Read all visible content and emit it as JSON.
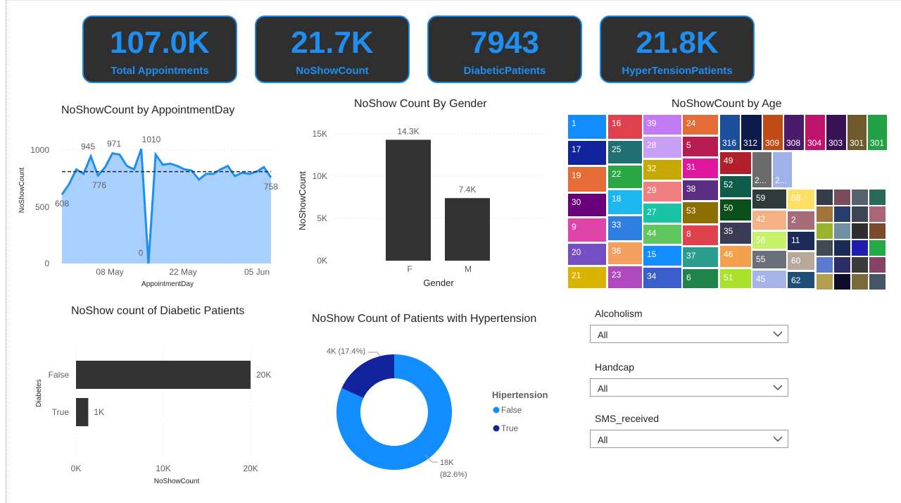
{
  "kpis": [
    {
      "value": "107.0K",
      "label": "Total Appointments"
    },
    {
      "value": "21.7K",
      "label": "NoShowCount"
    },
    {
      "value": "7943",
      "label": "DiabeticPatients"
    },
    {
      "value": "21.8K",
      "label": "HyperTensionPatients"
    }
  ],
  "colors": {
    "kpi_bg": "#2f2f2f",
    "kpi_accent": "#1f8ef1",
    "bar": "#333333",
    "area_fill": "#a8d0ff",
    "line": "#1f8ef1",
    "donut_false": "#118dff",
    "donut_true": "#12239e"
  },
  "charts": {
    "appointment_day": {
      "title": "NoShowCount by AppointmentDay",
      "ylabel": "NoShowCount",
      "xlabel": "AppointmentDay",
      "yticks": [
        "0",
        "500",
        "1000"
      ],
      "xticks": [
        "08 May",
        "22 May",
        "05 Jun"
      ],
      "labels": [
        "608",
        "945",
        "776",
        "971",
        "1010",
        "0",
        "758"
      ]
    },
    "gender": {
      "title": "NoShow Count By Gender",
      "ylabel": "NoShowCount",
      "xlabel": "Gender",
      "yticks": [
        "0K",
        "5K",
        "10K",
        "15K"
      ],
      "labels": [
        "14.3K",
        "7.4K"
      ],
      "categories": [
        "F",
        "M"
      ]
    },
    "age": {
      "title": "NoShowCount by Age"
    },
    "diabetes": {
      "title": "NoShow count of Diabetic Patients",
      "ylabel": "Diabetes",
      "xlabel": "NoShowCount",
      "categories": [
        "False",
        "True"
      ],
      "labels": [
        "20K",
        "1K"
      ],
      "xticks": [
        "0K",
        "10K",
        "20K"
      ]
    },
    "hypertension": {
      "title": "NoShow Count of Patients with Hypertension",
      "legend_title": "Hipertension",
      "legend": [
        "False",
        "True"
      ],
      "label_true": "4K (17.4%)",
      "label_false_1": "18K",
      "label_false_2": "(82.6%)"
    }
  },
  "chart_data": [
    {
      "type": "area",
      "title": "NoShowCount by AppointmentDay",
      "xlabel": "AppointmentDay",
      "ylabel": "NoShowCount",
      "ylim": [
        0,
        1150
      ],
      "values": [
        608,
        700,
        830,
        790,
        945,
        776,
        850,
        971,
        960,
        860,
        830,
        1010,
        0,
        960,
        870,
        880,
        860,
        830,
        820,
        740,
        790,
        790,
        830,
        860,
        770,
        800,
        790,
        810,
        850,
        758
      ],
      "average": 810
    },
    {
      "type": "bar",
      "title": "NoShow Count By Gender",
      "categories": [
        "F",
        "M"
      ],
      "values": [
        14300,
        7400
      ],
      "xlabel": "Gender",
      "ylabel": "NoShowCount",
      "ylim": [
        0,
        15000
      ]
    },
    {
      "type": "bar",
      "title": "NoShow count of Diabetic Patients",
      "categories": [
        "False",
        "True"
      ],
      "values": [
        20000,
        1400
      ],
      "xlabel": "NoShowCount",
      "ylabel": "Diabetes",
      "xlim": [
        0,
        20000
      ]
    },
    {
      "type": "pie",
      "title": "NoShow Count of Patients with Hypertension",
      "categories": [
        "False",
        "True"
      ],
      "values": [
        18000,
        4000
      ],
      "percent": [
        82.6,
        17.4
      ]
    }
  ],
  "treemap": [
    {
      "label": "1",
      "color": "#118dff"
    },
    {
      "label": "16",
      "color": "#e0414f"
    },
    {
      "label": "39",
      "color": "#c37bf5"
    },
    {
      "label": "24",
      "color": "#e66c37"
    },
    {
      "label": "17",
      "color": "#12239e"
    },
    {
      "label": "25",
      "color": "#1f6f73"
    },
    {
      "label": "28",
      "color": "#c89ef6"
    },
    {
      "label": "5",
      "color": "#b61c4d"
    },
    {
      "label": "19",
      "color": "#e66c37"
    },
    {
      "label": "22",
      "color": "#29a745"
    },
    {
      "label": "32",
      "color": "#c8a800"
    },
    {
      "label": "31",
      "color": "#e1169e"
    },
    {
      "label": "30",
      "color": "#6b007b"
    },
    {
      "label": "18",
      "color": "#1ab7f0"
    },
    {
      "label": "29",
      "color": "#f08080"
    },
    {
      "label": "38",
      "color": "#5a2d82"
    },
    {
      "label": "9",
      "color": "#e044a7"
    },
    {
      "label": "33",
      "color": "#2f7fe0"
    },
    {
      "label": "27",
      "color": "#19c4a6"
    },
    {
      "label": "53",
      "color": "#8d6e00"
    },
    {
      "label": "20",
      "color": "#744ec2"
    },
    {
      "label": "36",
      "color": "#f39f5e"
    },
    {
      "label": "44",
      "color": "#5ec85e"
    },
    {
      "label": "8",
      "color": "#e0414f"
    },
    {
      "label": "21",
      "color": "#d9b300"
    },
    {
      "label": "23",
      "color": "#b048c0"
    },
    {
      "label": "15",
      "color": "#118dff"
    },
    {
      "label": "37",
      "color": "#2a9d8f"
    },
    {
      "label": "34",
      "color": "#3a5fcd"
    },
    {
      "label": "6",
      "color": "#1e8449"
    },
    {
      "label": "316",
      "color": "#1b4f9c"
    },
    {
      "label": "312",
      "color": "#0d1b4c"
    },
    {
      "label": "309",
      "color": "#c04b14"
    },
    {
      "label": "308",
      "color": "#4a1a6b"
    },
    {
      "label": "304",
      "color": "#c0136b"
    },
    {
      "label": "303",
      "color": "#3a1356"
    },
    {
      "label": "301",
      "color": "#6e5a2a"
    },
    {
      "label": "301",
      "color": "#22a045"
    },
    {
      "label": "49",
      "color": "#b21f2b"
    },
    {
      "label": "52",
      "color": "#0f5c4a"
    },
    {
      "label": "50",
      "color": "#0a4f1a"
    },
    {
      "label": "35",
      "color": "#3b3b55"
    },
    {
      "label": "46",
      "color": "#f3a14b"
    },
    {
      "label": "51",
      "color": "#a8e22a"
    },
    {
      "label": "2...",
      "color": "#6b6b6b"
    },
    {
      "label": "2...",
      "color": "#9fb3e8"
    },
    {
      "label": "59",
      "color": "#2f3b3b"
    },
    {
      "label": "58",
      "color": "#ffe066"
    },
    {
      "label": "42",
      "color": "#f4b183"
    },
    {
      "label": "2",
      "color": "#a86b7a"
    },
    {
      "label": "56",
      "color": "#c6f26a"
    },
    {
      "label": "11",
      "color": "#1e2a5a"
    },
    {
      "label": "55",
      "color": "#6b6f7a"
    },
    {
      "label": "60",
      "color": "#b7a89a"
    },
    {
      "label": "45",
      "color": "#a7b4e8"
    },
    {
      "label": "62",
      "color": "#1f4e79"
    }
  ],
  "slicers": [
    {
      "label": "Alcoholism",
      "value": "All"
    },
    {
      "label": "Handcap",
      "value": "All"
    },
    {
      "label": "SMS_received",
      "value": "All"
    }
  ]
}
